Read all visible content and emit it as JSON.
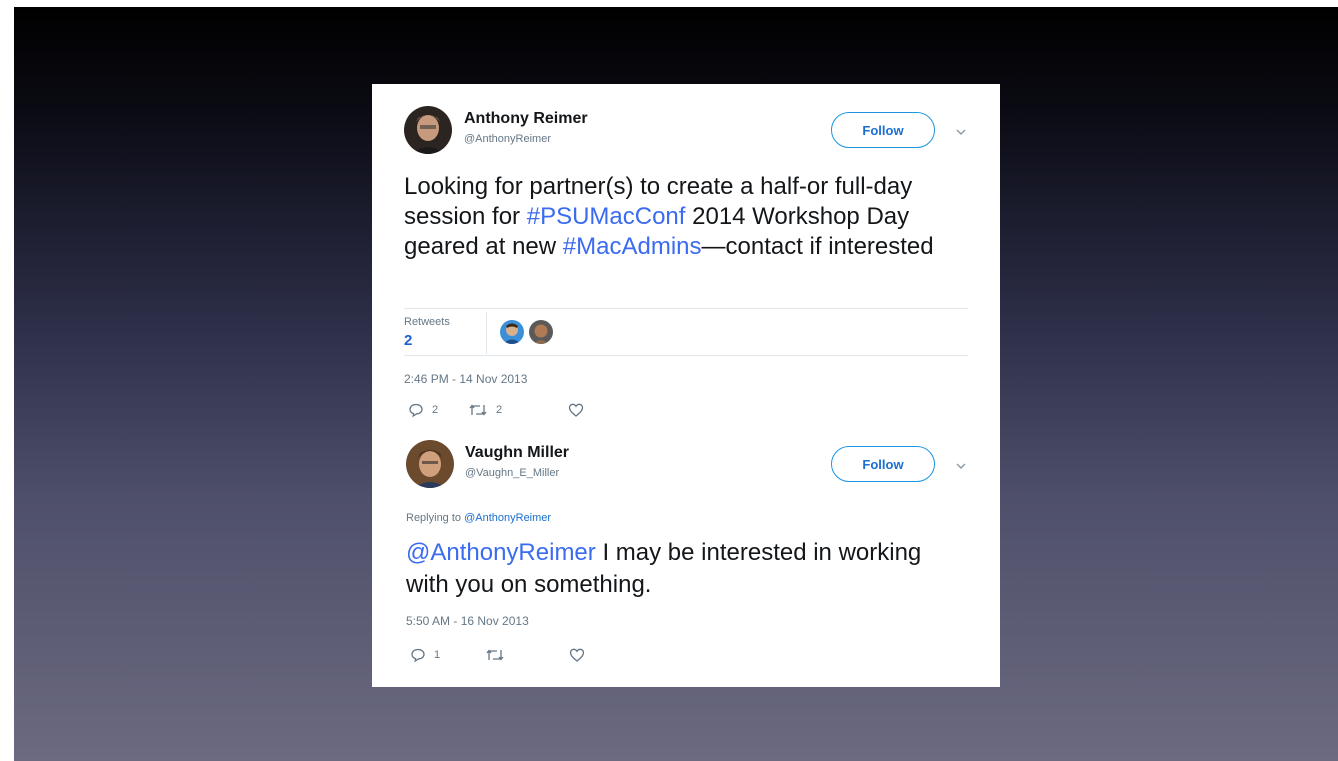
{
  "tweet": {
    "author_name": "Anthony Reimer",
    "author_handle": "@AnthonyReimer",
    "follow_label": "Follow",
    "text_part1": "Looking for partner(s) to create a half-or full-day session for ",
    "hashtag1": "#PSUMacConf",
    "text_part2": " 2014 Workshop Day geared at new ",
    "hashtag2": "#MacAdmins",
    "text_part3": "—contact if interested",
    "retweets_label": "Retweets",
    "retweets_count": "2",
    "timestamp": "2:46 PM - 14 Nov 2013",
    "reply_count": "2",
    "retweet_action_count": "2",
    "like_count": ""
  },
  "reply": {
    "author_name": "Vaughn Miller",
    "author_handle": "@Vaughn_E_Miller",
    "follow_label": "Follow",
    "replying_prefix": "Replying to ",
    "replying_to": "@AnthonyReimer",
    "mention": "@AnthonyReimer",
    "text": " I may be interested in working with you on something.",
    "timestamp": "5:50 AM - 16 Nov 2013",
    "reply_count": "1",
    "retweet_action_count": "",
    "like_count": ""
  },
  "colors": {
    "link": "#3b6bf0",
    "follow_border": "#1b95e0",
    "muted": "#657786"
  }
}
